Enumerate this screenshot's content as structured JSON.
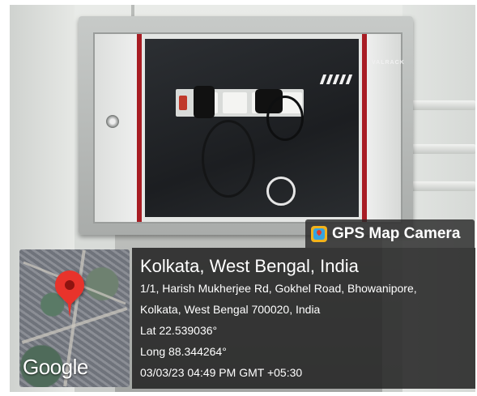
{
  "overlay": {
    "app_badge": "GPS Map Camera",
    "app_icon": "gps-map-camera-icon",
    "title": "Kolkata, West Bengal, India",
    "address_line1": "1/1, Harish Mukherjee Rd, Gokhel Road, Bhowanipore,",
    "address_line2": "Kolkata, West Bengal 700020, India",
    "latitude": "Lat 22.539036°",
    "longitude": "Long 88.344264°",
    "timestamp": "03/03/23 04:49 PM GMT +05:30",
    "map_logo": "Google",
    "pin_icon": "location-pin-icon",
    "colors": {
      "pin": "#e8332b",
      "panel": "#1e1e1e",
      "text": "#ffffff"
    }
  },
  "photo": {
    "cabinet_brand": "VALRACK"
  }
}
